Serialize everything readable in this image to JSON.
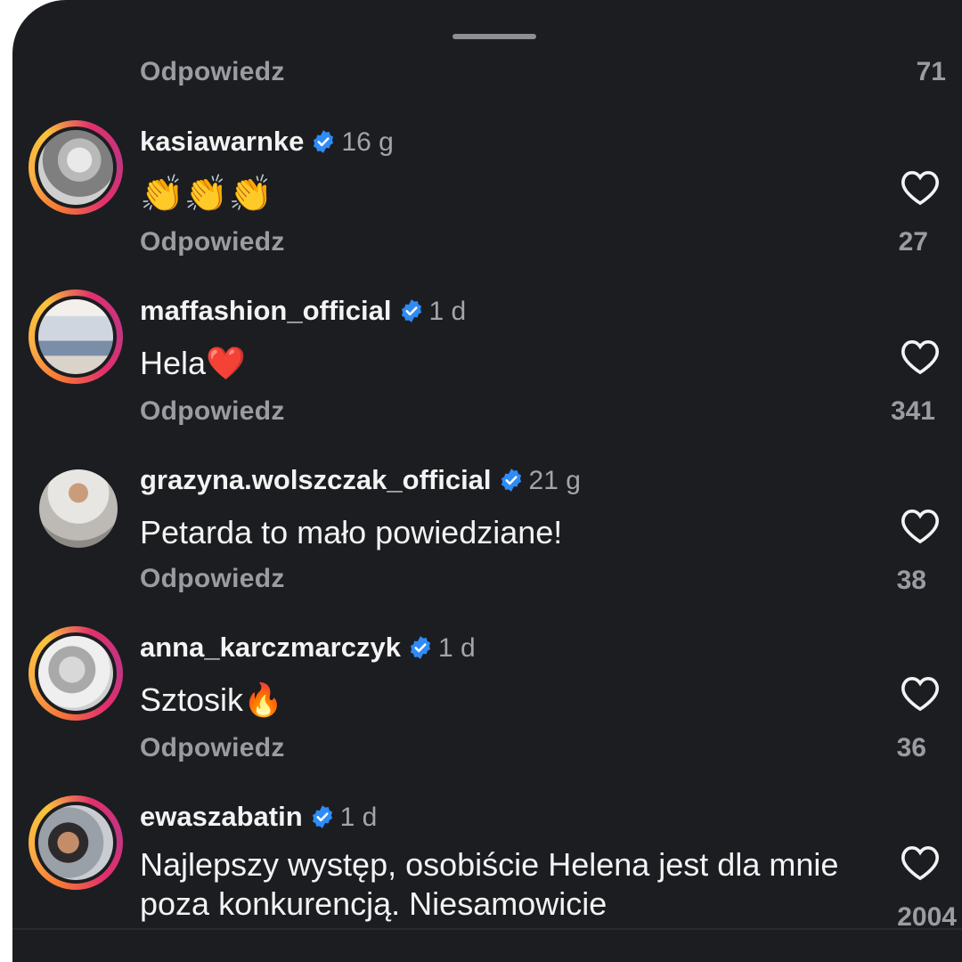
{
  "reply_label": "Odpowiedz",
  "top_count": "71",
  "comments": [
    {
      "user": "kasiawarnke",
      "time": "16 g",
      "text": "👏👏👏",
      "likes": "27"
    },
    {
      "user": "maffashion_official",
      "time": "1 d",
      "text": "Hela❤️",
      "likes": "341"
    },
    {
      "user": "grazyna.wolszczak_official",
      "time": "21 g",
      "text": "Petarda to mało powiedziane!",
      "likes": "38"
    },
    {
      "user": "anna_karczmarczyk",
      "time": "1 d",
      "text": "Sztosik🔥",
      "likes": "36"
    },
    {
      "user": "ewaszabatin",
      "time": "1 d",
      "text": "Najlepszy występ, osobiście Helena jest dla mnie poza konkurencją. Niesamowicie",
      "likes": "2004"
    }
  ],
  "icons": {
    "verified": "verified-badge-icon",
    "like": "heart-icon"
  },
  "colors": {
    "background": "#1c1d21",
    "verified": "#2f8bf5",
    "muted": "#9a9ca2"
  }
}
